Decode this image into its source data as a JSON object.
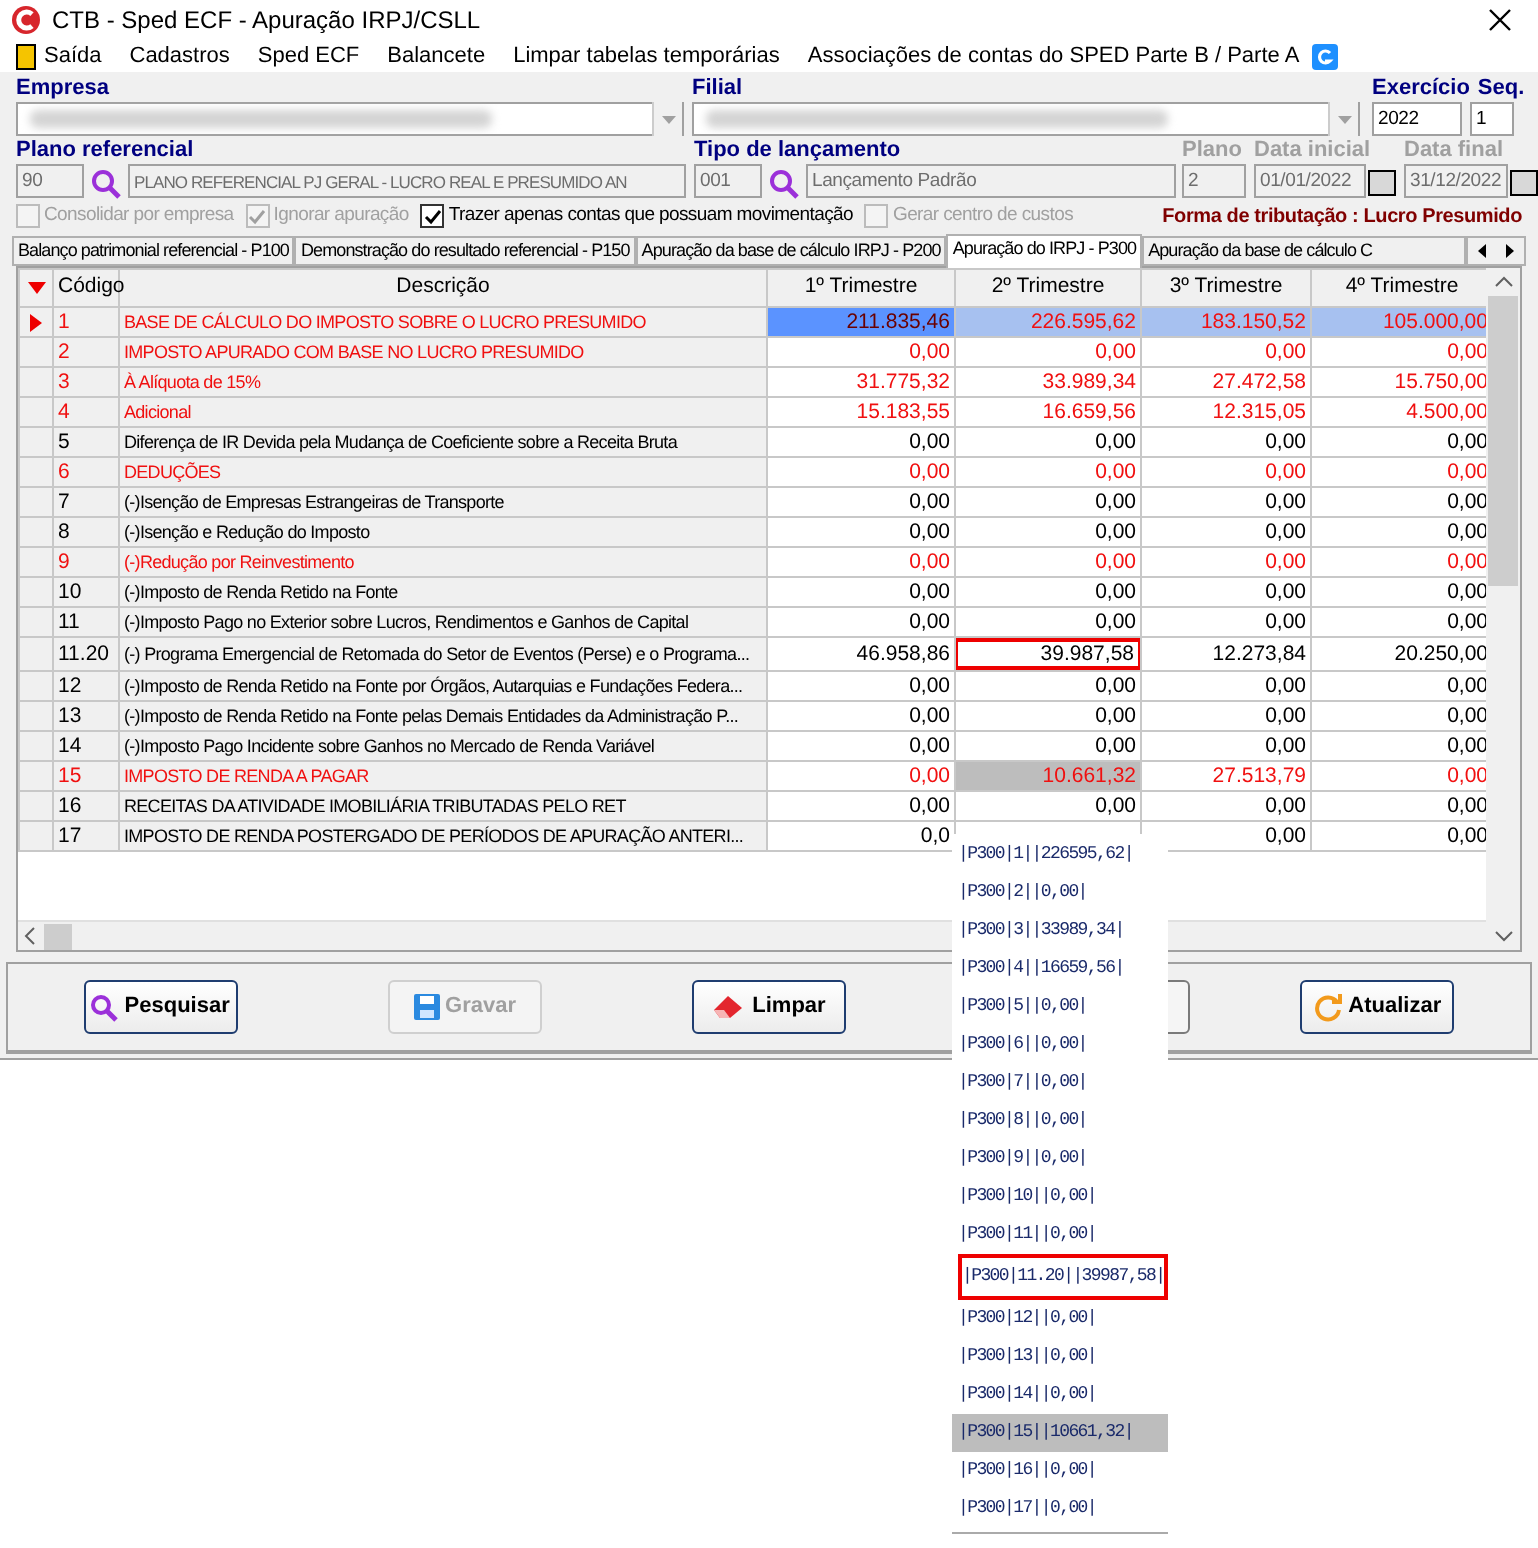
{
  "window": {
    "title": "CTB - Sped ECF - Apuração IRPJ/CSLL"
  },
  "menu": [
    "Saída",
    "Cadastros",
    "Sped ECF",
    "Balancete",
    "Limpar tabelas temporárias",
    "Associações de contas do SPED Parte B / Parte A"
  ],
  "form": {
    "empresa_label": "Empresa",
    "filial_label": "Filial",
    "exercicio_label": "Exercício",
    "seq_label": "Seq.",
    "exercicio": "2022",
    "seq": "1",
    "plano_label": "Plano referencial",
    "plano_code": "90",
    "plano_name": "PLANO REFERENCIAL PJ GERAL - LUCRO REAL E PRESUMIDO AN",
    "tipo_label": "Tipo de lançamento",
    "tipo_code": "001",
    "tipo_name": "Lançamento Padrão",
    "plano2_label": "Plano",
    "plano2": "2",
    "data_inicial_label": "Data inicial",
    "data_inicial": "01/01/2022",
    "data_final_label": "Data final",
    "data_final": "31/12/2022"
  },
  "options": [
    {
      "label": "Consolidar por empresa",
      "checked": false,
      "disabled": true
    },
    {
      "label": "Ignorar apuração",
      "checked": true,
      "disabled": true
    },
    {
      "label": "Trazer apenas contas que possuam movimentação",
      "checked": true,
      "disabled": false
    },
    {
      "label": "Gerar centro de custos",
      "checked": false,
      "disabled": true
    }
  ],
  "tributacao": "Forma de tributação : Lucro Presumido",
  "tabs": [
    {
      "label": "Balanço patrimonial referencial - P100",
      "selected": false
    },
    {
      "label": "Demonstração do resultado referencial - P150",
      "selected": false
    },
    {
      "label": "Apuração da base de cálculo IRPJ - P200",
      "selected": false
    },
    {
      "label": "Apuração do IRPJ - P300",
      "selected": true
    },
    {
      "label": "Apuração da base de cálculo C",
      "selected": false
    }
  ],
  "table": {
    "columns": [
      "Código",
      "Descrição",
      "1º Trimestre",
      "2º Trimestre",
      "3º Trimestre",
      "4º Trimestre"
    ],
    "rows": [
      {
        "code": "1",
        "description": "BASE DE CÁLCULO DO IMPOSTO SOBRE O LUCRO PRESUMIDO",
        "red": true,
        "selected": true,
        "values": [
          {
            "text": "211.835,46",
            "kind": "focused"
          },
          {
            "text": "226.595,62",
            "kind": "plain"
          },
          {
            "text": "183.150,52",
            "kind": "plain"
          },
          {
            "text": "105.000,00",
            "kind": "plain"
          }
        ]
      },
      {
        "code": "2",
        "description": "IMPOSTO APURADO COM BASE NO LUCRO PRESUMIDO",
        "red": true,
        "selected": false,
        "values": [
          {
            "text": "0,00",
            "kind": "plain"
          },
          {
            "text": "0,00",
            "kind": "plain"
          },
          {
            "text": "0,00",
            "kind": "plain"
          },
          {
            "text": "0,00",
            "kind": "plain"
          }
        ]
      },
      {
        "code": "3",
        "description": "À Alíquota de 15%",
        "red": true,
        "selected": false,
        "values": [
          {
            "text": "31.775,32",
            "kind": "plain"
          },
          {
            "text": "33.989,34",
            "kind": "plain"
          },
          {
            "text": "27.472,58",
            "kind": "plain"
          },
          {
            "text": "15.750,00",
            "kind": "plain"
          }
        ]
      },
      {
        "code": "4",
        "description": "Adicional",
        "red": true,
        "selected": false,
        "values": [
          {
            "text": "15.183,55",
            "kind": "plain"
          },
          {
            "text": "16.659,56",
            "kind": "plain"
          },
          {
            "text": "12.315,05",
            "kind": "plain"
          },
          {
            "text": "4.500,00",
            "kind": "plain"
          }
        ]
      },
      {
        "code": "5",
        "description": "Diferença de IR Devida pela Mudança de Coeficiente sobre a Receita Bruta",
        "red": false,
        "selected": false,
        "values": [
          {
            "text": "0,00",
            "kind": "plain"
          },
          {
            "text": "0,00",
            "kind": "plain"
          },
          {
            "text": "0,00",
            "kind": "plain"
          },
          {
            "text": "0,00",
            "kind": "plain"
          }
        ]
      },
      {
        "code": "6",
        "description": "DEDUÇÕES",
        "red": true,
        "selected": false,
        "values": [
          {
            "text": "0,00",
            "kind": "plain"
          },
          {
            "text": "0,00",
            "kind": "plain"
          },
          {
            "text": "0,00",
            "kind": "plain"
          },
          {
            "text": "0,00",
            "kind": "plain"
          }
        ]
      },
      {
        "code": "7",
        "description": "(-)Isenção de Empresas Estrangeiras de Transporte",
        "red": false,
        "selected": false,
        "values": [
          {
            "text": "0,00",
            "kind": "plain"
          },
          {
            "text": "0,00",
            "kind": "plain"
          },
          {
            "text": "0,00",
            "kind": "plain"
          },
          {
            "text": "0,00",
            "kind": "plain"
          }
        ]
      },
      {
        "code": "8",
        "description": "(-)Isenção e Redução do Imposto",
        "red": false,
        "selected": false,
        "values": [
          {
            "text": "0,00",
            "kind": "plain"
          },
          {
            "text": "0,00",
            "kind": "plain"
          },
          {
            "text": "0,00",
            "kind": "plain"
          },
          {
            "text": "0,00",
            "kind": "plain"
          }
        ]
      },
      {
        "code": "9",
        "description": "(-)Redução por Reinvestimento",
        "red": true,
        "selected": false,
        "values": [
          {
            "text": "0,00",
            "kind": "plain"
          },
          {
            "text": "0,00",
            "kind": "plain"
          },
          {
            "text": "0,00",
            "kind": "plain"
          },
          {
            "text": "0,00",
            "kind": "plain"
          }
        ]
      },
      {
        "code": "10",
        "description": "(-)Imposto de Renda Retido na Fonte",
        "red": false,
        "selected": false,
        "values": [
          {
            "text": "0,00",
            "kind": "plain"
          },
          {
            "text": "0,00",
            "kind": "plain"
          },
          {
            "text": "0,00",
            "kind": "plain"
          },
          {
            "text": "0,00",
            "kind": "plain"
          }
        ]
      },
      {
        "code": "11",
        "description": "(-)Imposto Pago no Exterior sobre Lucros, Rendimentos e Ganhos de Capital",
        "red": false,
        "selected": false,
        "values": [
          {
            "text": "0,00",
            "kind": "plain"
          },
          {
            "text": "0,00",
            "kind": "plain"
          },
          {
            "text": "0,00",
            "kind": "plain"
          },
          {
            "text": "0,00",
            "kind": "plain"
          }
        ]
      },
      {
        "code": "11.20",
        "description": "(-) Programa Emergencial de Retomada do Setor de Eventos (Perse) e o Programa...",
        "red": false,
        "selected": false,
        "values": [
          {
            "text": "46.958,86",
            "kind": "plain"
          },
          {
            "text": "39.987,58",
            "kind": "outlined"
          },
          {
            "text": "12.273,84",
            "kind": "plain"
          },
          {
            "text": "20.250,00",
            "kind": "plain"
          }
        ]
      },
      {
        "code": "12",
        "description": "(-)Imposto de Renda Retido na Fonte por Órgãos, Autarquias e Fundações Federa...",
        "red": false,
        "selected": false,
        "values": [
          {
            "text": "0,00",
            "kind": "plain"
          },
          {
            "text": "0,00",
            "kind": "plain"
          },
          {
            "text": "0,00",
            "kind": "plain"
          },
          {
            "text": "0,00",
            "kind": "plain"
          }
        ]
      },
      {
        "code": "13",
        "description": "(-)Imposto de Renda Retido na Fonte pelas Demais Entidades da Administração P...",
        "red": false,
        "selected": false,
        "values": [
          {
            "text": "0,00",
            "kind": "plain"
          },
          {
            "text": "0,00",
            "kind": "plain"
          },
          {
            "text": "0,00",
            "kind": "plain"
          },
          {
            "text": "0,00",
            "kind": "plain"
          }
        ]
      },
      {
        "code": "14",
        "description": "(-)Imposto Pago Incidente sobre Ganhos no Mercado de Renda Variável",
        "red": false,
        "selected": false,
        "values": [
          {
            "text": "0,00",
            "kind": "plain"
          },
          {
            "text": "0,00",
            "kind": "plain"
          },
          {
            "text": "0,00",
            "kind": "plain"
          },
          {
            "text": "0,00",
            "kind": "plain"
          }
        ]
      },
      {
        "code": "15",
        "description": "IMPOSTO DE RENDA A PAGAR",
        "red": true,
        "selected": false,
        "values": [
          {
            "text": "0,00",
            "kind": "plain"
          },
          {
            "text": "10.661,32",
            "kind": "shaded"
          },
          {
            "text": "27.513,79",
            "kind": "plain"
          },
          {
            "text": "0,00",
            "kind": "plain"
          }
        ]
      },
      {
        "code": "16",
        "description": "RECEITAS DA ATIVIDADE IMOBILIÁRIA TRIBUTADAS PELO RET",
        "red": false,
        "selected": false,
        "values": [
          {
            "text": "0,00",
            "kind": "plain"
          },
          {
            "text": "0,00",
            "kind": "plain"
          },
          {
            "text": "0,00",
            "kind": "plain"
          },
          {
            "text": "0,00",
            "kind": "plain"
          }
        ]
      },
      {
        "code": "17",
        "description": "IMPOSTO DE RENDA POSTERGADO DE PERÍODOS DE APURAÇÃO ANTERI...",
        "red": false,
        "selected": false,
        "values": [
          {
            "text": "0,0",
            "kind": "plain"
          },
          {
            "kind": "covered"
          },
          {
            "text": "0,00",
            "kind": "plain"
          },
          {
            "text": "0,00",
            "kind": "plain"
          }
        ]
      }
    ]
  },
  "buttons": [
    {
      "label": "Pesquisar",
      "kind": "search",
      "disabled": false
    },
    {
      "label": "Gravar",
      "kind": "save",
      "disabled": true
    },
    {
      "label": "Limpar",
      "kind": "clear",
      "disabled": false
    },
    {
      "kind": "hidden"
    },
    {
      "label": "Atualizar",
      "kind": "refresh",
      "disabled": false
    }
  ],
  "export_lines": [
    {
      "text": "|P300|1||226595,62|",
      "kind": "plain"
    },
    {
      "text": "|P300|2||0,00|",
      "kind": "plain"
    },
    {
      "text": "|P300|3||33989,34|",
      "kind": "plain"
    },
    {
      "text": "|P300|4||16659,56|",
      "kind": "plain"
    },
    {
      "text": "|P300|5||0,00|",
      "kind": "plain"
    },
    {
      "text": "|P300|6||0,00|",
      "kind": "plain"
    },
    {
      "text": "|P300|7||0,00|",
      "kind": "plain"
    },
    {
      "text": "|P300|8||0,00|",
      "kind": "plain"
    },
    {
      "text": "|P300|9||0,00|",
      "kind": "plain"
    },
    {
      "text": "|P300|10||0,00|",
      "kind": "plain"
    },
    {
      "text": "|P300|11||0,00|",
      "kind": "plain"
    },
    {
      "text": "|P300|11.20||39987,58|",
      "kind": "outlined"
    },
    {
      "text": "|P300|12||0,00|",
      "kind": "plain"
    },
    {
      "text": "|P300|13||0,00|",
      "kind": "plain"
    },
    {
      "text": "|P300|14||0,00|",
      "kind": "plain"
    },
    {
      "text": "|P300|15||10661,32|",
      "kind": "shaded"
    },
    {
      "text": "|P300|16||0,00|",
      "kind": "plain"
    },
    {
      "text": "|P300|17||0,00|",
      "kind": "plain"
    }
  ]
}
